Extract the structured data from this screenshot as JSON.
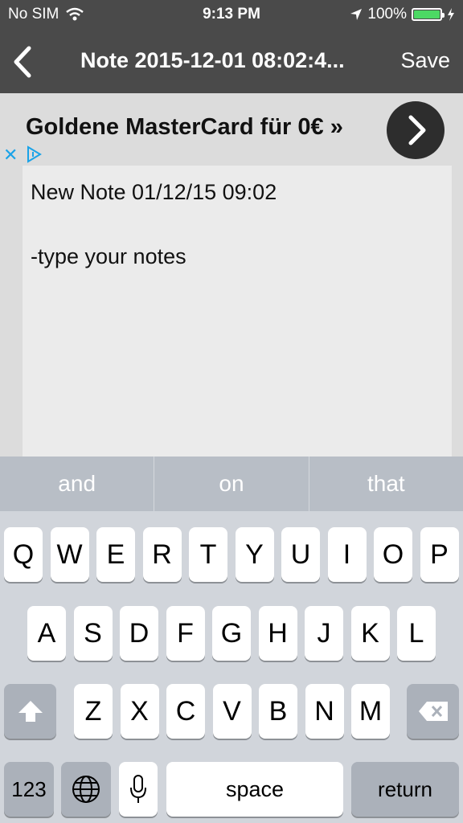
{
  "status_bar": {
    "carrier": "No SIM",
    "time": "9:13 PM",
    "battery": "100%",
    "battery_level": 1.0,
    "battery_color": "#4cd964"
  },
  "nav": {
    "title": "Note 2015-12-01 08:02:4...",
    "save_label": "Save",
    "back_icon": "chevron-left-icon"
  },
  "ad": {
    "text": "Goldene MasterCard für 0€ »",
    "arrow_icon": "chevron-right-icon",
    "close_glyph": "✕"
  },
  "note": {
    "lines": [
      "New Note 01/12/15 09:02",
      "",
      "-type your notes"
    ]
  },
  "keyboard": {
    "suggestions": [
      "and",
      "on",
      "that"
    ],
    "row1": [
      "Q",
      "W",
      "E",
      "R",
      "T",
      "Y",
      "U",
      "I",
      "O",
      "P"
    ],
    "row2": [
      "A",
      "S",
      "D",
      "F",
      "G",
      "H",
      "J",
      "K",
      "L"
    ],
    "row3": [
      "Z",
      "X",
      "C",
      "V",
      "B",
      "N",
      "M"
    ],
    "numbers_label": "123",
    "space_label": "space",
    "return_label": "return"
  }
}
